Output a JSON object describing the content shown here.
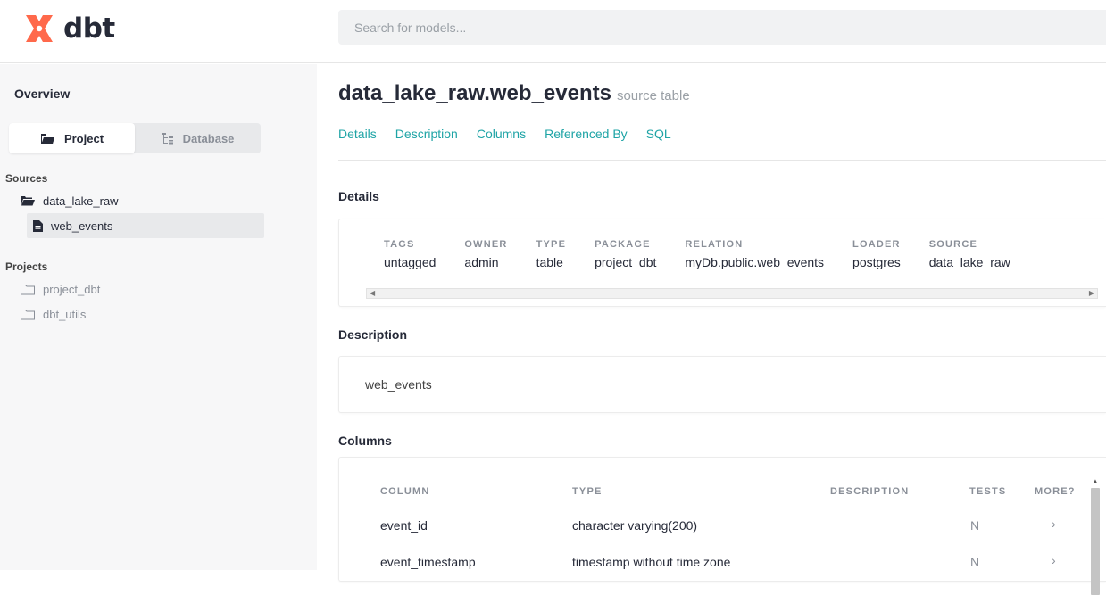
{
  "header": {
    "logo_text": "dbt",
    "search_placeholder": "Search for models..."
  },
  "sidebar": {
    "overview": "Overview",
    "switch": {
      "project": "Project",
      "database": "Database"
    },
    "sources_heading": "Sources",
    "sources": {
      "folder": "data_lake_raw",
      "table": "web_events"
    },
    "projects_heading": "Projects",
    "projects": [
      "project_dbt",
      "dbt_utils"
    ]
  },
  "main": {
    "title": "data_lake_raw.web_events",
    "subtitle": "source table",
    "tabs": [
      "Details",
      "Description",
      "Columns",
      "Referenced By",
      "SQL"
    ],
    "details_heading": "Details",
    "details": [
      {
        "label": "TAGS",
        "value": "untagged"
      },
      {
        "label": "OWNER",
        "value": "admin"
      },
      {
        "label": "TYPE",
        "value": "table"
      },
      {
        "label": "PACKAGE",
        "value": "project_dbt"
      },
      {
        "label": "RELATION",
        "value": "myDb.public.web_events"
      },
      {
        "label": "LOADER",
        "value": "postgres"
      },
      {
        "label": "SOURCE",
        "value": "data_lake_raw"
      }
    ],
    "description_heading": "Description",
    "description_text": "web_events",
    "columns_heading": "Columns",
    "columns_headers": [
      "COLUMN",
      "TYPE",
      "DESCRIPTION",
      "TESTS",
      "MORE?"
    ],
    "columns_rows": [
      {
        "column": "event_id",
        "type": "character varying(200)",
        "description": "",
        "tests": "N",
        "more": "›"
      },
      {
        "column": "event_timestamp",
        "type": "timestamp without time zone",
        "description": "",
        "tests": "N",
        "more": "›"
      }
    ]
  },
  "colors": {
    "accent": "#1fa4a6",
    "logo": "#ff694b",
    "sidebar_bg": "#f7f7f8"
  }
}
